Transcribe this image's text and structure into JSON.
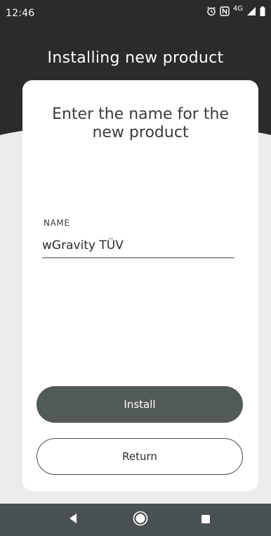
{
  "status_bar": {
    "time": "12:46",
    "network": "4G",
    "icons": [
      "alarm-icon",
      "nfc-icon",
      "signal-icon",
      "battery-icon"
    ]
  },
  "header": {
    "title": "Installing new product"
  },
  "card": {
    "title": "Enter the name for the new product",
    "name_field": {
      "label": "NAME",
      "value": "wGravity TÜV"
    },
    "install_label": "Install",
    "return_label": "Return"
  },
  "nav_bar": {
    "buttons": [
      "back-icon",
      "home-icon",
      "recents-icon"
    ]
  },
  "colors": {
    "header_bg": "#2b2b2b",
    "screen_bg": "#ececec",
    "card_bg": "#ffffff",
    "primary_button": "#525a58",
    "nav_bar": "#4a5152"
  }
}
